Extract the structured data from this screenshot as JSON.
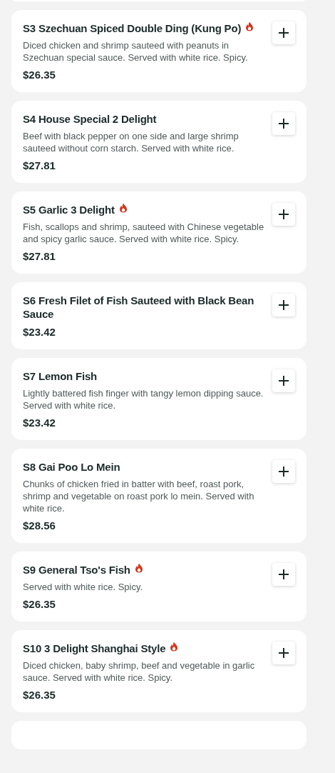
{
  "items": [
    {
      "name": "S3 Szechuan Spiced Double Ding (Kung Po)",
      "spicy": true,
      "description": "Diced chicken and shrimp sauteed with peanuts in Szechuan special sauce. Served with white rice. Spicy.",
      "price": "$26.35"
    },
    {
      "name": "S4 House Special 2 Delight",
      "spicy": false,
      "description": "Beef with black pepper on one side and large shrimp sauteed without corn starch. Served with white rice.",
      "price": "$27.81"
    },
    {
      "name": "S5 Garlic 3 Delight",
      "spicy": true,
      "description": "Fish, scallops and shrimp, sauteed with Chinese vegetable and spicy garlic sauce. Served with white rice. Spicy.",
      "price": "$27.81"
    },
    {
      "name": "S6 Fresh Filet of Fish Sauteed with Black Bean Sauce",
      "spicy": false,
      "price": "$23.42"
    },
    {
      "name": "S7 Lemon Fish",
      "spicy": false,
      "description": "Lightly battered fish finger with tangy lemon dipping sauce. Served with white rice.",
      "price": "$23.42"
    },
    {
      "name": "S8 Gai Poo Lo Mein",
      "spicy": false,
      "description": "Chunks of chicken fried in batter with beef, roast pork, shrimp and vegetable on roast pork lo mein. Served with white rice.",
      "price": "$28.56"
    },
    {
      "name": "S9 General Tso's Fish",
      "spicy": true,
      "description": "Served with white rice. Spicy.",
      "price": "$26.35"
    },
    {
      "name": "S10 3 Delight Shanghai Style",
      "spicy": true,
      "description": "Diced chicken, baby shrimp, beef and vegetable in garlic sauce. Served with white rice. Spicy.",
      "price": "$26.35"
    }
  ]
}
